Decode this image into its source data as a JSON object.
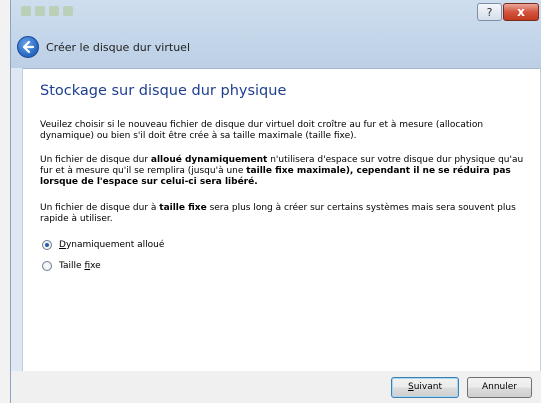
{
  "window": {
    "help_label": "?",
    "close_label": "x"
  },
  "nav": {
    "title": "Créer le disque dur virtuel"
  },
  "page": {
    "heading": "Stockage sur disque dur physique",
    "para1": "Veuilez choisir si le nouveau fichier de disque dur virtuel doit croître au fur et à mesure (allocation dynamique) ou bien s'il doit être crée à sa taille maximale (taille fixe).",
    "para2": {
      "t1": "Un fichier de disque dur ",
      "b1": "alloué dynamiquement",
      "t2": " n'utilisera d'espace sur votre disque dur physique qu'au fur et à mesure qu'il se remplira (jusqu'à une ",
      "b2": "taille fixe maximale), cependant il ne se réduira pas lorsque de l'espace sur celui-ci sera libéré."
    },
    "para3": {
      "t1": "Un fichier de disque dur à ",
      "b1": "taille fixe",
      "t2": " sera plus long à créer sur certains systèmes mais sera souvent plus rapide à utiliser."
    }
  },
  "options": [
    {
      "prefix": "",
      "accel": "D",
      "rest": "ynamiquement alloué",
      "checked": true
    },
    {
      "prefix": "Taille ",
      "accel": "f",
      "rest": "ixe",
      "checked": false
    }
  ],
  "buttons": {
    "next": {
      "accel": "S",
      "rest": "uivant"
    },
    "cancel": "Annuler"
  }
}
